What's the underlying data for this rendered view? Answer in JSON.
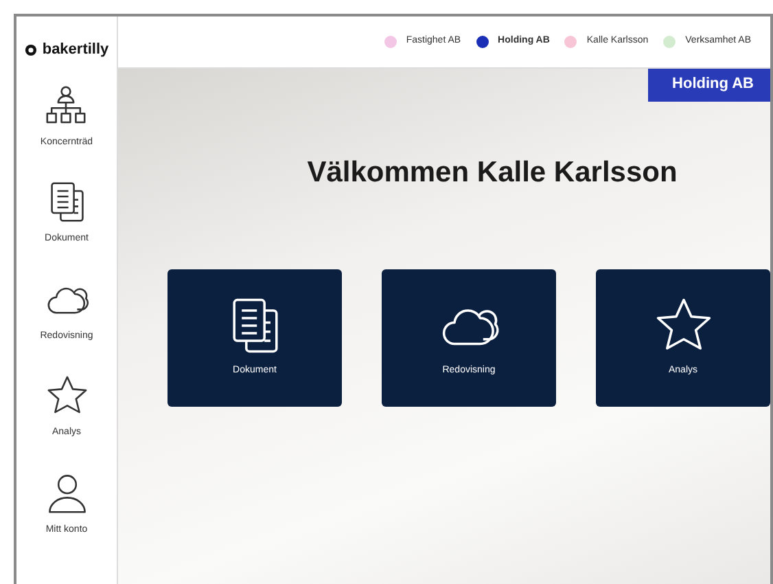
{
  "logo": {
    "text": "bakertilly"
  },
  "companies": [
    {
      "label": "Fastighet AB",
      "color": "#f4c6e6",
      "selected": false
    },
    {
      "label": "Holding AB",
      "color": "#1a2fb5",
      "selected": true
    },
    {
      "label": "Kalle Karlsson",
      "color": "#f7c5d5",
      "selected": false
    },
    {
      "label": "Verksamhet AB",
      "color": "#d3ecd0",
      "selected": false
    }
  ],
  "sidebar": {
    "items": [
      {
        "label": "Koncernträd"
      },
      {
        "label": "Dokument"
      },
      {
        "label": "Redovisning"
      },
      {
        "label": "Analys"
      },
      {
        "label": "Mitt konto"
      }
    ]
  },
  "active_company_badge": "Holding AB",
  "welcome_title": "Välkommen Kalle Karlsson",
  "tiles": [
    {
      "label": "Dokument"
    },
    {
      "label": "Redovisning"
    },
    {
      "label": "Analys"
    }
  ]
}
